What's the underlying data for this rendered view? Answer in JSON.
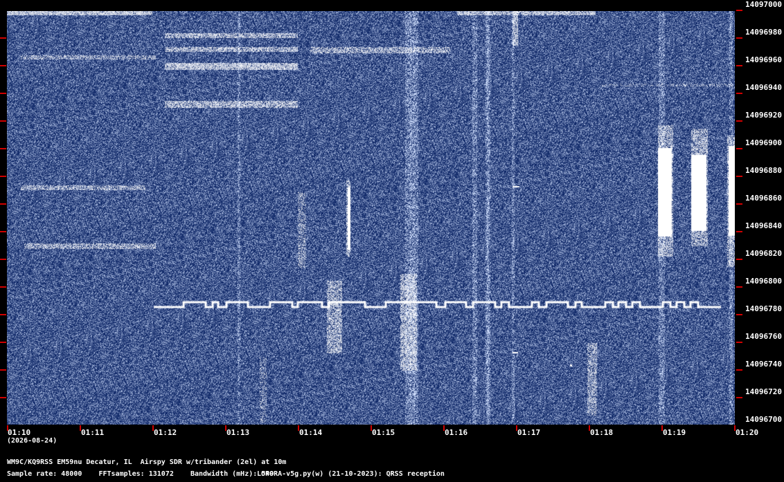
{
  "window": {
    "date_label": "(2026-08-24)",
    "station": "WM9C/KQ9RSS EM59nu Decatur, IL  Airspy SDR w/tribander (2el) at 10m",
    "sample_rate_label": "Sample rate: 48000",
    "fft_label": "FFTsamples: 131072",
    "bandwidth_label": "Bandwidth (mHz): 549",
    "software": "LOPORA-v5g.py(w) (21-10-2023): QRSS reception"
  },
  "colors": {
    "background": "#000000",
    "waterfall_base": "#0b2a6a",
    "signal": "#ffffff",
    "tick": "#d00000"
  },
  "freq_axis": {
    "labels": [
      "14097000",
      "14096980",
      "14096960",
      "14096940",
      "14096920",
      "14096900",
      "14096880",
      "14096860",
      "14096840",
      "14096820",
      "14096800",
      "14096780",
      "14096760",
      "14096740",
      "14096720",
      "14096700"
    ]
  },
  "time_axis": {
    "labels": [
      "01:10",
      "01:11",
      "01:12",
      "01:13",
      "01:14",
      "01:15",
      "01:16",
      "01:17",
      "01:18",
      "01:19",
      "01:20"
    ]
  }
}
